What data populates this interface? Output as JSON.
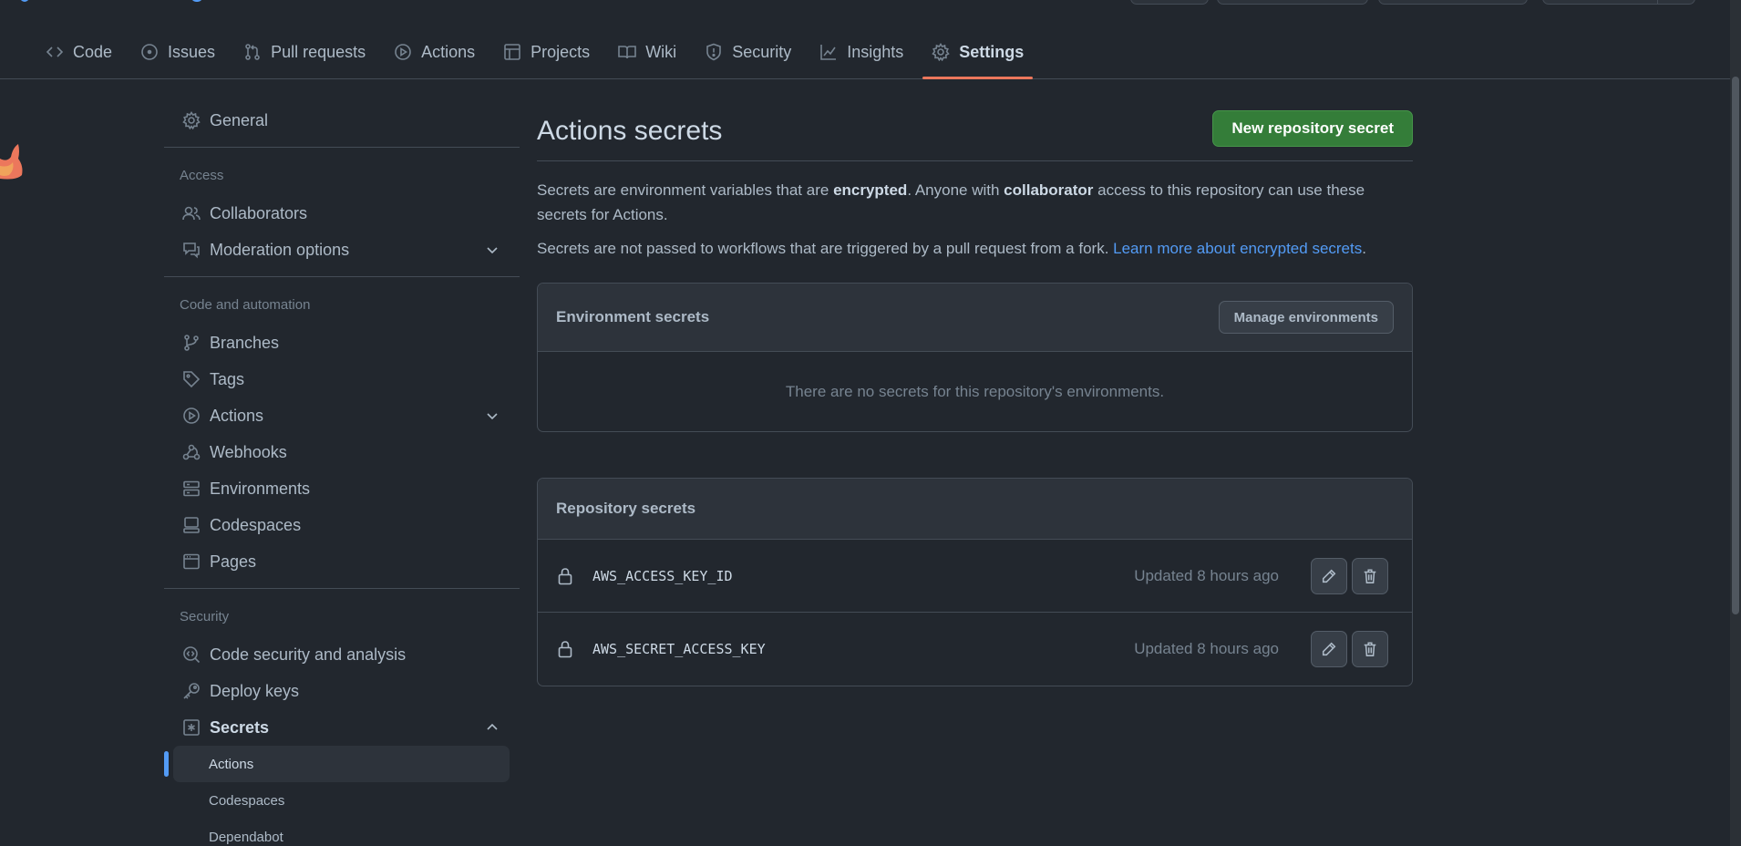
{
  "nav": {
    "tabs": [
      {
        "label": "Code",
        "icon": "code-icon"
      },
      {
        "label": "Issues",
        "icon": "issue-icon"
      },
      {
        "label": "Pull requests",
        "icon": "pull-request-icon"
      },
      {
        "label": "Actions",
        "icon": "play-icon"
      },
      {
        "label": "Projects",
        "icon": "table-icon"
      },
      {
        "label": "Wiki",
        "icon": "book-icon"
      },
      {
        "label": "Security",
        "icon": "shield-icon"
      },
      {
        "label": "Insights",
        "icon": "graph-icon"
      },
      {
        "label": "Settings",
        "icon": "gear-icon",
        "selected": true
      }
    ]
  },
  "sidebar": {
    "general": "General",
    "access_heading": "Access",
    "collaborators": "Collaborators",
    "moderation": "Moderation options",
    "code_heading": "Code and automation",
    "branches": "Branches",
    "tags": "Tags",
    "actions": "Actions",
    "webhooks": "Webhooks",
    "environments": "Environments",
    "codespaces": "Codespaces",
    "pages": "Pages",
    "security_heading": "Security",
    "code_security": "Code security and analysis",
    "deploy_keys": "Deploy keys",
    "secrets": "Secrets",
    "secrets_sub": [
      "Actions",
      "Codespaces",
      "Dependabot"
    ]
  },
  "main": {
    "title": "Actions secrets",
    "new_button": "New repository secret",
    "desc1": {
      "a": "Secrets are environment variables that are ",
      "b": "encrypted",
      "c": ". Anyone with ",
      "d": "collaborator",
      "e": " access to this repository can use these secrets for Actions."
    },
    "desc2": {
      "text": "Secrets are not passed to workflows that are triggered by a pull request from a fork. ",
      "link": "Learn more about encrypted secrets",
      "end": "."
    },
    "env": {
      "title": "Environment secrets",
      "manage_button": "Manage environments",
      "empty": "There are no secrets for this repository's environments."
    },
    "repo": {
      "title": "Repository secrets",
      "secrets": [
        {
          "name": "AWS_ACCESS_KEY_ID",
          "updated": "Updated 8 hours ago"
        },
        {
          "name": "AWS_SECRET_ACCESS_KEY",
          "updated": "Updated 8 hours ago"
        }
      ]
    }
  },
  "colors": {
    "background": "#22272e",
    "primary_button": "#347d39",
    "selected_tab_underline": "#ec775c",
    "link": "#539bf5"
  }
}
